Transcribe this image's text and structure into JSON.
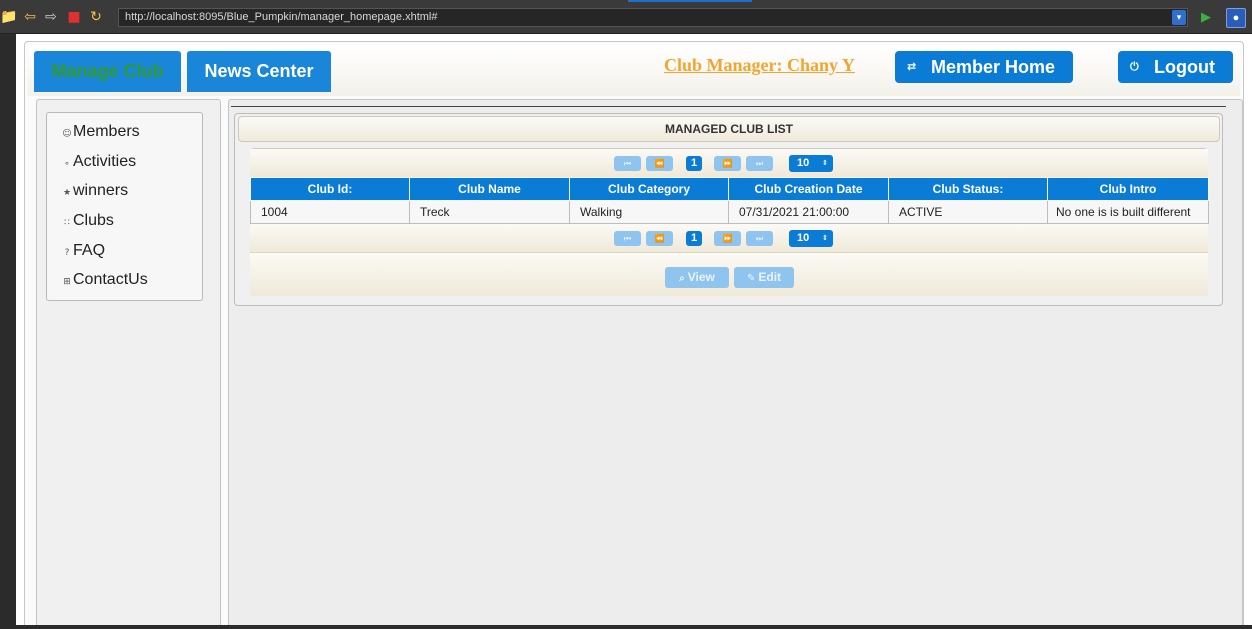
{
  "browser": {
    "url": "http://localhost:8095/Blue_Pumpkin/manager_homepage.xhtml#",
    "icons": [
      "folder-icon",
      "back-arrow-icon",
      "forward-arrow-icon",
      "stop-icon",
      "refresh-icon",
      "url-dropdown-icon",
      "go-icon",
      "extension-icon"
    ]
  },
  "header": {
    "tabs": [
      {
        "label": "Manage Club",
        "color": "#2f9a2f"
      },
      {
        "label": "News Center",
        "color": "#ffffff"
      }
    ],
    "manager_link": "Club Manager: Chany Y",
    "member_home": "Member Home",
    "logout": "Logout"
  },
  "sidebar": {
    "items": [
      {
        "label": "Members",
        "icon": "person-icon"
      },
      {
        "label": "Activities",
        "icon": "link-icon"
      },
      {
        "label": "winners",
        "icon": "star-icon"
      },
      {
        "label": "Clubs",
        "icon": "rss-icon"
      },
      {
        "label": "FAQ",
        "icon": "question-icon"
      },
      {
        "label": "ContactUs",
        "icon": "contact-card-icon"
      }
    ]
  },
  "club_list": {
    "title": "MANAGED CLUB LIST",
    "current_page": "1",
    "rows_per_page": "10",
    "columns": [
      "Club Id:",
      "Club Name",
      "Club Category",
      "Club Creation Date",
      "Club Status:",
      "Club Intro"
    ],
    "rows": [
      [
        "1004",
        "Treck",
        "Walking",
        "07/31/2021 21:00:00",
        "ACTIVE",
        "No one is is built different"
      ]
    ],
    "actions": {
      "view": "View",
      "edit": "Edit"
    }
  },
  "colors": {
    "primary_blue": "#0a7cd6",
    "disabled_blue": "#8fc4ef",
    "manager_orange": "#f4a52f",
    "manage_green": "#2f9a2f"
  }
}
